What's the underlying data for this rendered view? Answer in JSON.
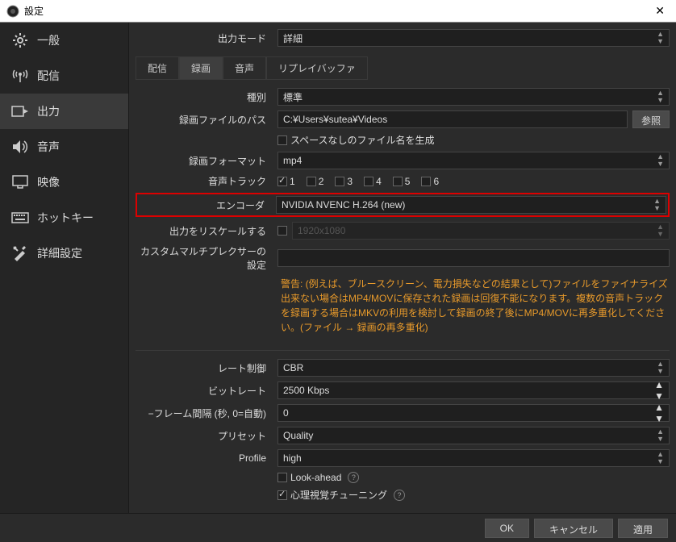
{
  "window": {
    "title": "設定"
  },
  "sidebar": {
    "items": [
      {
        "label": "一般"
      },
      {
        "label": "配信"
      },
      {
        "label": "出力"
      },
      {
        "label": "音声"
      },
      {
        "label": "映像"
      },
      {
        "label": "ホットキー"
      },
      {
        "label": "詳細設定"
      }
    ]
  },
  "main": {
    "output_mode_label": "出力モード",
    "output_mode_value": "詳細",
    "tabs": [
      {
        "label": "配信"
      },
      {
        "label": "録画"
      },
      {
        "label": "音声"
      },
      {
        "label": "リプレイバッファ"
      }
    ],
    "type_label": "種別",
    "type_value": "標準",
    "rec_path_label": "録画ファイルのパス",
    "rec_path_value": "C:¥Users¥sutea¥Videos",
    "browse_label": "参照",
    "no_space_label": "スペースなしのファイル名を生成",
    "rec_format_label": "録画フォーマット",
    "rec_format_value": "mp4",
    "tracks_label": "音声トラック",
    "track_labels": [
      "1",
      "2",
      "3",
      "4",
      "5",
      "6"
    ],
    "encoder_label": "エンコーダ",
    "encoder_value": "NVIDIA NVENC H.264 (new)",
    "rescale_label": "出力をリスケールする",
    "rescale_value": "1920x1080",
    "mux_label": "カスタムマルチプレクサーの設定",
    "warning": "警告: (例えば、ブルースクリーン、電力損失などの結果として)ファイルをファイナライズ出来ない場合はMP4/MOVに保存された録画は回復不能になります。複数の音声トラックを録画する場合はMKVの利用を検討して録画の終了後にMP4/MOVに再多重化してください。(ファイル → 録画の再多重化)",
    "rate_control_label": "レート制御",
    "rate_control_value": "CBR",
    "bitrate_label": "ビットレート",
    "bitrate_value": "2500 Kbps",
    "keyint_label": "−フレーム間隔 (秒, 0=自動)",
    "keyint_value": "0",
    "preset_label": "プリセット",
    "preset_value": "Quality",
    "profile_label": "Profile",
    "profile_value": "high",
    "lookahead_label": "Look-ahead",
    "psycho_label": "心理視覚チューニング"
  },
  "buttons": {
    "ok": "OK",
    "cancel": "キャンセル",
    "apply": "適用"
  }
}
